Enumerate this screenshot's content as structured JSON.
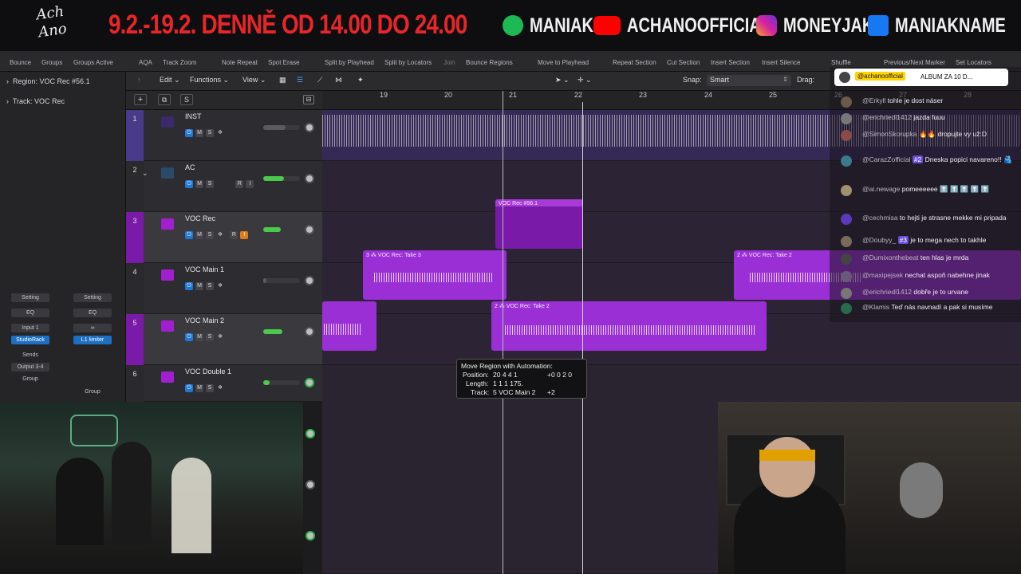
{
  "banner": {
    "logo": "Ach Ano",
    "dates": "9.2.-19.2. DENNĚ OD 14.00 DO 24.00",
    "socials": [
      {
        "platform": "spotify-icon",
        "label": "MANIAK",
        "color": "#1DB954"
      },
      {
        "platform": "youtube-icon",
        "label": "ACHANOOFFICIAL",
        "color": "#FF0000"
      },
      {
        "platform": "instagram-icon",
        "label": "MONEYJAK",
        "color": "#E1306C"
      },
      {
        "platform": "facebook-icon",
        "label": "MANIAKNAME",
        "color": "#1877F2"
      }
    ]
  },
  "toolbar": [
    "Bounce",
    "Groups",
    "Groups Active",
    "AQA",
    "Track Zoom",
    "Note Repeat",
    "Spot Erase",
    "Split by Playhead",
    "Split by Locators",
    "Join",
    "Bounce Regions",
    "Move to Playhead",
    "Repeat Section",
    "Cut Section",
    "Insert Section",
    "Insert Silence",
    "Shuffle",
    "Previous/Next Marker",
    "Set Locators"
  ],
  "inspector": {
    "region": "Region: VOC Rec #56.1",
    "track": "Track: VOC Rec",
    "strip_left": {
      "setting": "Setting",
      "eq": "EQ",
      "input": "Input 1",
      "plugin": "StudioRack",
      "sends": "Sends",
      "output": "Output 3-4",
      "group": "Group"
    },
    "strip_right": {
      "setting": "Setting",
      "eq": "EQ",
      "link": "∞",
      "plugin": "L1 limiter",
      "group": "Group"
    }
  },
  "menubar": {
    "edit": "Edit",
    "functions": "Functions",
    "view": "View",
    "snap_label": "Snap:",
    "snap_value": "Smart",
    "drag_label": "Drag:"
  },
  "ruler": [
    "19",
    "20",
    "21",
    "22",
    "23",
    "24",
    "25",
    "26",
    "27",
    "28"
  ],
  "tracks": [
    {
      "num": "1",
      "name": "INST",
      "buttons": [
        "M",
        "S"
      ]
    },
    {
      "num": "2",
      "name": "AC",
      "buttons": [
        "M",
        "S",
        "R",
        "I"
      ]
    },
    {
      "num": "3",
      "name": "VOC Rec",
      "buttons": [
        "M",
        "S",
        "R",
        "I"
      ]
    },
    {
      "num": "4",
      "name": "VOC Main 1",
      "buttons": [
        "M",
        "S"
      ]
    },
    {
      "num": "5",
      "name": "VOC Main 2",
      "buttons": [
        "M",
        "S"
      ]
    },
    {
      "num": "6",
      "name": "VOC Double 1",
      "buttons": [
        "M",
        "S"
      ]
    }
  ],
  "regions": {
    "voc_rec": "VOC Rec #56.1",
    "take3": "3 ⁂ VOC Rec: Take 3",
    "take2a": "2 ⁂ VOC Rec: Take 2",
    "take2b": "2 ⁂ VOC Rec: Take 2"
  },
  "tooltip": {
    "title": "Move Region with Automation:",
    "position_label": "Position:",
    "position_value": "20 4 4 1",
    "position_delta": "+0 0 2 0",
    "length_label": "Length:",
    "length_value": "1 1 1 175.",
    "track_label": "Track:",
    "track_value": "5  VOC Main 2",
    "track_delta": "+2"
  },
  "chat": {
    "pinned_user": "@achanoofficial",
    "pinned_text": "ALBUM ZA 10 D...",
    "messages": [
      {
        "user": "@Erkyll",
        "text": "tohle je dost náser"
      },
      {
        "user": "@erichriedl1412",
        "text": "jazda fuuu"
      },
      {
        "user": "@SimonSkorupka",
        "text": "🔥🔥 dropujte vy už:D"
      },
      {
        "user": "@CarazZofficial",
        "badge": "#2",
        "text": "Dneska popici navareno!! 🫂"
      },
      {
        "user": "@ai.newage",
        "text": "pomeeeeee ⬆️ ⬆️ ⬆️ ⬆️ ⬆️"
      },
      {
        "user": "@cechmisa",
        "text": "to hejti je strasne mekke mi pripada"
      },
      {
        "user": "@Doubyy_",
        "badge": "#3",
        "text": "je to mega nech to takhle"
      },
      {
        "user": "@Dumixonthebeat",
        "text": "ten hlas je mrda"
      },
      {
        "user": "@maxipejsek",
        "text": "nechat aspoň nabehne jinak"
      },
      {
        "user": "@erichriedl1412",
        "text": "dobře je to urvane"
      },
      {
        "user": "@Klamis",
        "text": "Teď nás navnadí a pak si musíme"
      }
    ]
  },
  "accent": {
    "purple": "#9b2fd6",
    "purple_dark": "#7a1aa8",
    "selected_track": "#3a3a3e"
  }
}
